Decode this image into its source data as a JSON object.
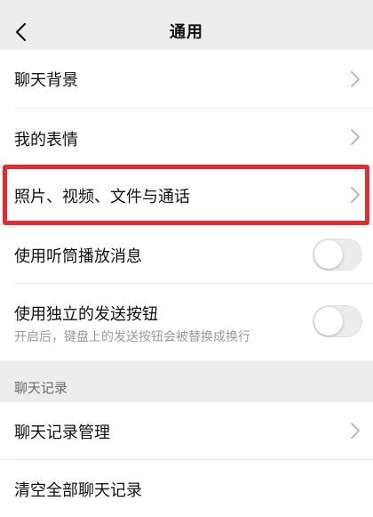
{
  "navbar": {
    "title": "通用",
    "back_icon": "chevron-left-icon"
  },
  "settings": {
    "chat_background": "聊天背景",
    "my_stickers": "我的表情",
    "photos_videos_files_calls": "照片、视频、文件与通话",
    "earpiece_playback": {
      "label": "使用听筒播放消息",
      "enabled": false
    },
    "separate_send_button": {
      "label": "使用独立的发送按钮",
      "description": "开启后，键盘上的发送按钮会被替换成换行",
      "enabled": false
    }
  },
  "chat_history_section": {
    "header": "聊天记录",
    "manage": "聊天记录管理",
    "clear_all_partial": "清空全部聊天记录"
  },
  "colors": {
    "background": "#ededed",
    "row_background": "#ffffff",
    "highlight_border": "#e32c2f",
    "secondary_text": "#9b9b9b"
  }
}
